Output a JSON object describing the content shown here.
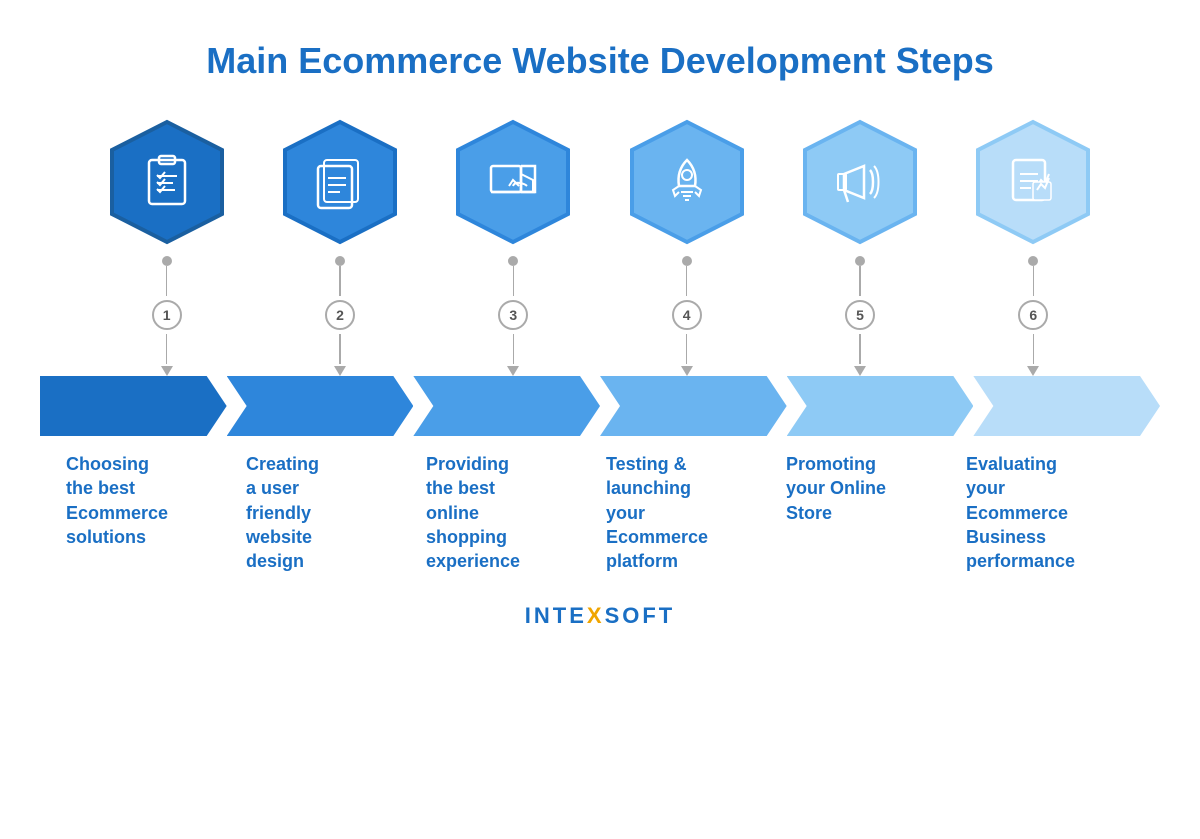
{
  "title": "Main Ecommerce Website Development Steps",
  "brand": "INTEXSOFT",
  "steps": [
    {
      "number": "1",
      "label": "Choosing\nthe best\nEcommerce\nsolutions",
      "color_fill": "#1a6fc4",
      "color_border": "#1a5fa0",
      "icon": "clipboard"
    },
    {
      "number": "2",
      "label": "Creating\na user\nfriendly\nwebsite\ndesign",
      "color_fill": "#2e86db",
      "color_border": "#1a6fc4",
      "icon": "documents"
    },
    {
      "number": "3",
      "label": "Providing\nthe best\nonline\nshopping\nexperience",
      "color_fill": "#4a9ee8",
      "color_border": "#2e86db",
      "icon": "delivery"
    },
    {
      "number": "4",
      "label": "Testing &\nlaunching\nyour\nEcommerce\nplatform",
      "color_fill": "#6ab4f0",
      "color_border": "#4a9ee8",
      "icon": "rocket"
    },
    {
      "number": "5",
      "label": "Promoting\nyour Online\nStore",
      "color_fill": "#8ecaf5",
      "color_border": "#6ab4f0",
      "icon": "megaphone"
    },
    {
      "number": "6",
      "label": "Evaluating\nyour\nEcommerce\nBusiness\nperformance",
      "color_fill": "#b8ddf9",
      "color_border": "#8ecaf5",
      "icon": "report"
    }
  ],
  "ribbon_colors": [
    "#1a6fc4",
    "#2e86db",
    "#4a9ee8",
    "#6ab4f0",
    "#8ecaf5",
    "#b8ddf9"
  ]
}
